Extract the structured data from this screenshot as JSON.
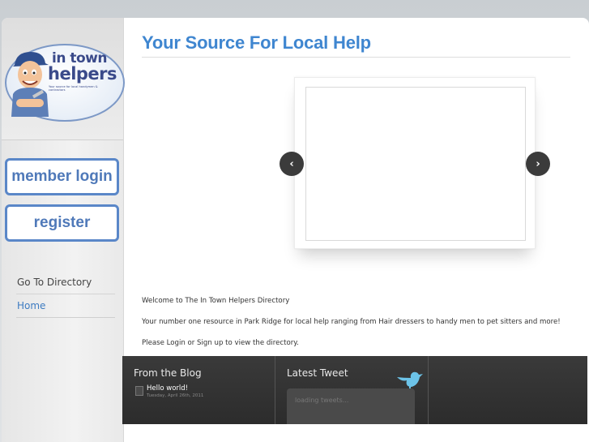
{
  "logo": {
    "line1": "in town",
    "line2": "helpers",
    "tagline": "Your source for local handymen & contractors"
  },
  "sidebar": {
    "member_login": "member login",
    "register": "register",
    "nav": [
      {
        "label": "Go To Directory"
      },
      {
        "label": "Home"
      }
    ]
  },
  "main": {
    "title": "Your Source For Local Help",
    "slider": {
      "prev_icon": "‹",
      "next_icon": "›"
    },
    "paragraphs": [
      "Welcome to The In Town Helpers Directory",
      "Your number one resource in Park Ridge for local help ranging from Hair dressers to handy men to pet sitters and more!",
      "Please Login or Sign up to view the directory."
    ]
  },
  "footer": {
    "blog": {
      "heading": "From the Blog",
      "post_title": "Hello world!",
      "post_date": "Tuesday, April 26th, 2011"
    },
    "tweet": {
      "heading": "Latest Tweet",
      "status": "loading tweets..."
    }
  },
  "colors": {
    "accent": "#3f86d0",
    "button_border": "#5a87c8",
    "footer_bg": "#333333"
  }
}
